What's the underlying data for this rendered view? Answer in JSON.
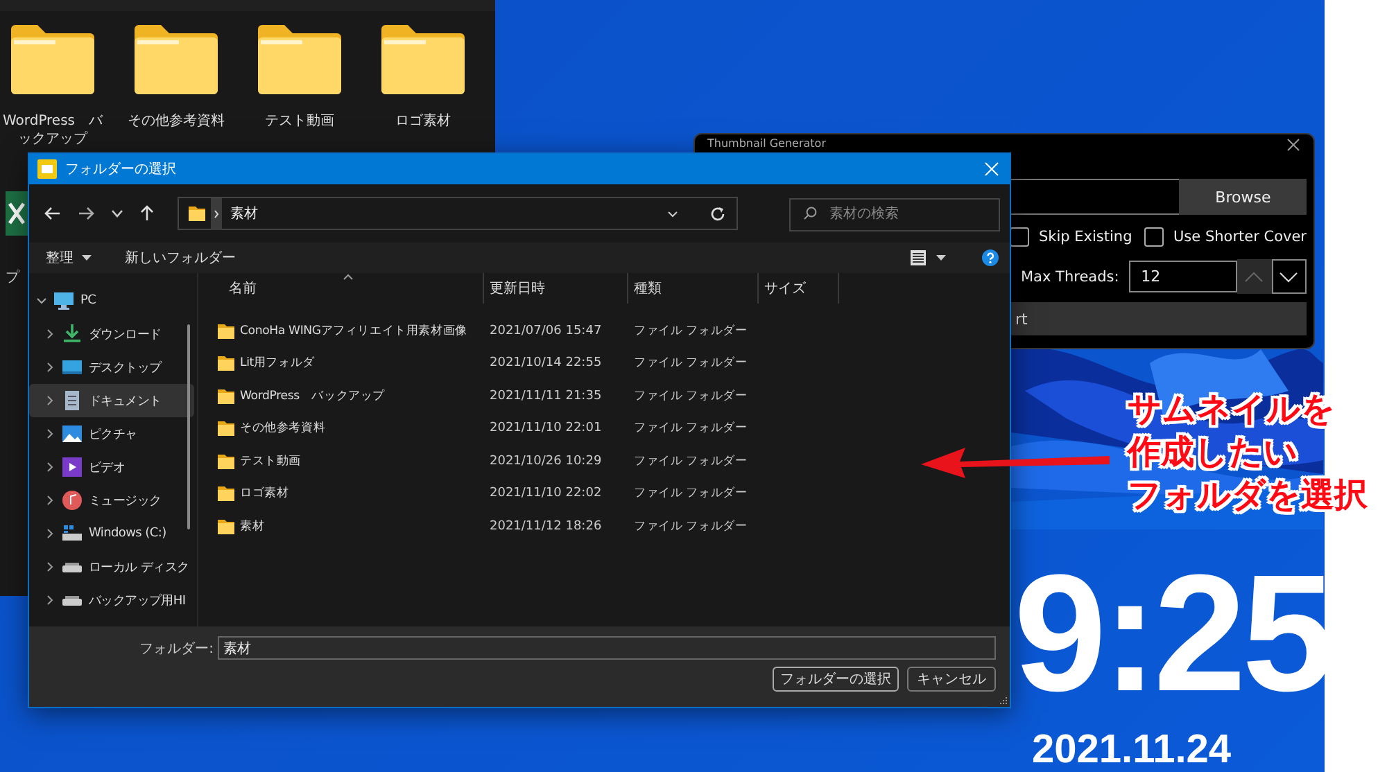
{
  "background_window": {
    "folders": [
      {
        "name": "WordPress　バックアップ"
      },
      {
        "name": "その他参考資料"
      },
      {
        "name": "テスト動画"
      },
      {
        "name": "ロゴ素材"
      }
    ],
    "side_item": {
      "label": "プ"
    }
  },
  "thumbnail_generator": {
    "title": "Thumbnail Generator",
    "browse_button": "Browse",
    "options": [
      {
        "label": "Skip Existing",
        "checked": false
      },
      {
        "label": "Use Shorter Cover",
        "checked": false
      }
    ],
    "max_threads": {
      "label": "Max Threads:",
      "value": "12"
    },
    "start_button": "rt"
  },
  "dialog": {
    "title": "フォルダーの選択",
    "address": "素材",
    "search_placeholder": "素材の検索",
    "toolbar": {
      "organize": "整理",
      "new_folder": "新しいフォルダー"
    },
    "nav": [
      {
        "label": "PC",
        "kind": "pc",
        "expanded": true,
        "selected": false,
        "children": [
          {
            "label": "ダウンロード",
            "kind": "download",
            "expanded": false,
            "selected": false
          },
          {
            "label": "デスクトップ",
            "kind": "desktop",
            "expanded": false,
            "selected": false
          },
          {
            "label": "ドキュメント",
            "kind": "documents",
            "expanded": false,
            "selected": true
          },
          {
            "label": "ピクチャ",
            "kind": "pictures",
            "expanded": false,
            "selected": false
          },
          {
            "label": "ビデオ",
            "kind": "videos",
            "expanded": false,
            "selected": false
          },
          {
            "label": "ミュージック",
            "kind": "music",
            "expanded": false,
            "selected": false
          },
          {
            "label": "Windows (C:)",
            "kind": "system-drive",
            "expanded": false,
            "selected": false
          },
          {
            "label": "ローカル ディスク",
            "kind": "drive",
            "expanded": false,
            "selected": false
          },
          {
            "label": "バックアップ用HI",
            "kind": "drive",
            "expanded": false,
            "selected": false
          }
        ]
      }
    ],
    "columns": [
      "名前",
      "更新日時",
      "種類",
      "サイズ"
    ],
    "rows": [
      {
        "name": "ConoHa WINGアフィリエイト用素材画像",
        "modified": "2021/07/06 15:47",
        "type": "ファイル フォルダー"
      },
      {
        "name": "Lit用フォルダ",
        "modified": "2021/10/14 22:55",
        "type": "ファイル フォルダー"
      },
      {
        "name": "WordPress　バックアップ",
        "modified": "2021/11/11 21:35",
        "type": "ファイル フォルダー"
      },
      {
        "name": "その他参考資料",
        "modified": "2021/11/10 22:01",
        "type": "ファイル フォルダー"
      },
      {
        "name": "テスト動画",
        "modified": "2021/10/26 10:29",
        "type": "ファイル フォルダー"
      },
      {
        "name": "ロゴ素材",
        "modified": "2021/11/10 22:02",
        "type": "ファイル フォルダー"
      },
      {
        "name": "素材",
        "modified": "2021/11/12 18:26",
        "type": "ファイル フォルダー"
      }
    ],
    "folder_label": "フォルダー:",
    "folder_value": "素材",
    "buttons": [
      "フォルダーの選択",
      "キャンセル"
    ]
  },
  "annotation": {
    "lines": [
      "サムネイルを",
      "作成したい",
      "フォルダを選択"
    ]
  },
  "clock": {
    "time": "9:25",
    "date": "2021.11.24"
  }
}
